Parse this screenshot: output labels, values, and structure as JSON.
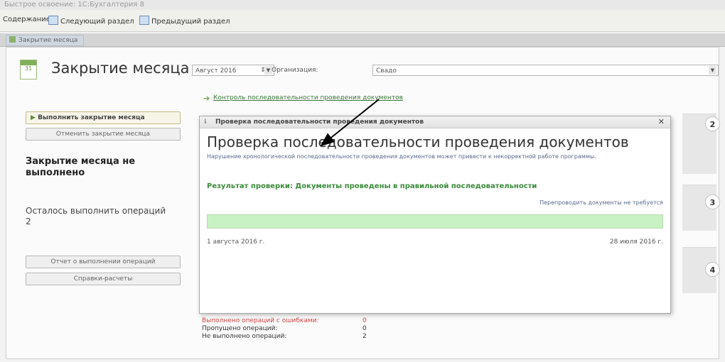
{
  "window": {
    "title": "Быстрое освоение: 1С:Бухгалтерия 8"
  },
  "nav": {
    "contents": "Содержание",
    "next_section": "Следующий раздел",
    "prev_section": "Предыдущий раздел"
  },
  "tab": {
    "label": "Закрытие месяца"
  },
  "header": {
    "title": "Закрытие месяца",
    "calendar_day": "31",
    "period": "Август 2016",
    "organization_label": "Организация:",
    "organization": "Свадо",
    "control_link": "Контроль последовательности проведения документов"
  },
  "left": {
    "run_button": "Выполнить закрытие месяца",
    "cancel_button": "Отменить закрытие месяца",
    "status": "Закрытие месяца не выполнено",
    "remaining": "Осталось выполнить операций 2",
    "report_button": "Отчет о выполнении операций",
    "calc_button": "Справки-расчеты"
  },
  "dialog": {
    "header": "Проверка последовательности проведения документов",
    "title": "Проверка последовательности проведения документов",
    "description": "Нарушение хронологической последовательности проведения документов может привести к некорректной работе программы.",
    "result": "Результат проверки: Документы проведены в правильной последовательности",
    "repost_link": "Перепроводить документы не требуется",
    "progress": 1.0,
    "date_start": "1 августа 2016 г.",
    "date_end": "28 июля 2016 г.",
    "close_glyph": "✕"
  },
  "stages": [
    "2",
    "3",
    "4"
  ],
  "stats": [
    {
      "label": "Выполнено операций с ошибками:",
      "value": "0"
    },
    {
      "label": "Пропущено операций:",
      "value": "0"
    },
    {
      "label": "Не выполнено операций:",
      "value": "2"
    }
  ]
}
